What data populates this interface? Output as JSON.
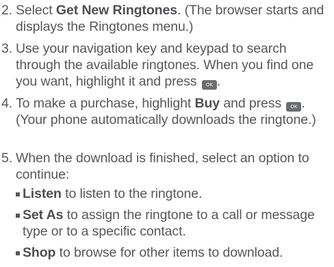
{
  "steps": [
    {
      "number": "2.",
      "parts": [
        {
          "t": "Select "
        },
        {
          "t": "Get New Ringtones",
          "b": true
        },
        {
          "t": ". (The browser starts and displays the Ringtones menu.)"
        }
      ]
    },
    {
      "number": "3.",
      "parts": [
        {
          "t": "Use your navigation key and keypad to search through the available ringtones. When you find one you want, highlight it and press "
        },
        {
          "key": "OK"
        },
        {
          "t": "."
        }
      ]
    },
    {
      "number": "4.",
      "parts": [
        {
          "t": "To make a purchase, highlight "
        },
        {
          "t": "Buy",
          "b": true
        },
        {
          "t": " and press "
        },
        {
          "key": "OK"
        },
        {
          "t": ". (Your phone automatically downloads the ringtone.)"
        }
      ]
    },
    {
      "number": "5.",
      "parts": [
        {
          "t": "When the download is finished, select an option to continue:"
        }
      ]
    }
  ],
  "options": [
    {
      "label": "Listen",
      "text": " to listen to the ringtone."
    },
    {
      "label": "Set As",
      "text": " to assign the ringtone to a call or message type or to a specific contact."
    },
    {
      "label": "Shop",
      "text": " to browse for other items to download."
    }
  ]
}
